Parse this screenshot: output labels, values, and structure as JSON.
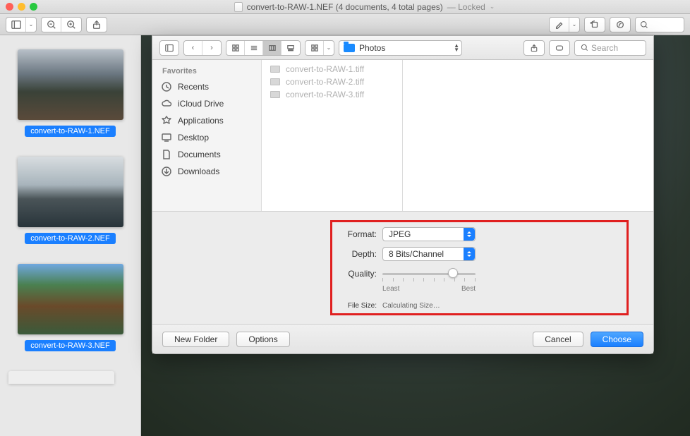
{
  "window": {
    "title": "convert-to-RAW-1.NEF (4 documents, 4 total pages)",
    "locked_label": "— Locked"
  },
  "thumbs": [
    {
      "label": "convert-to-RAW-1.NEF"
    },
    {
      "label": "convert-to-RAW-2.NEF"
    },
    {
      "label": "convert-to-RAW-3.NEF"
    }
  ],
  "sheet": {
    "path_label": "Photos",
    "search_placeholder": "Search",
    "favorites_header": "Favorites",
    "favorites": [
      {
        "icon": "clock",
        "label": "Recents"
      },
      {
        "icon": "cloud",
        "label": "iCloud Drive"
      },
      {
        "icon": "apps",
        "label": "Applications"
      },
      {
        "icon": "desktop",
        "label": "Desktop"
      },
      {
        "icon": "doc",
        "label": "Documents"
      },
      {
        "icon": "download",
        "label": "Downloads"
      }
    ],
    "files": [
      "convert-to-RAW-1.tiff",
      "convert-to-RAW-2.tiff",
      "convert-to-RAW-3.tiff"
    ],
    "options": {
      "format_label": "Format:",
      "format_value": "JPEG",
      "depth_label": "Depth:",
      "depth_value": "8 Bits/Channel",
      "quality_label": "Quality:",
      "quality_percent": 76,
      "quality_least": "Least",
      "quality_best": "Best",
      "filesize_label": "File Size:",
      "filesize_value": "Calculating Size…"
    },
    "buttons": {
      "new_folder": "New Folder",
      "options": "Options",
      "cancel": "Cancel",
      "choose": "Choose"
    }
  }
}
